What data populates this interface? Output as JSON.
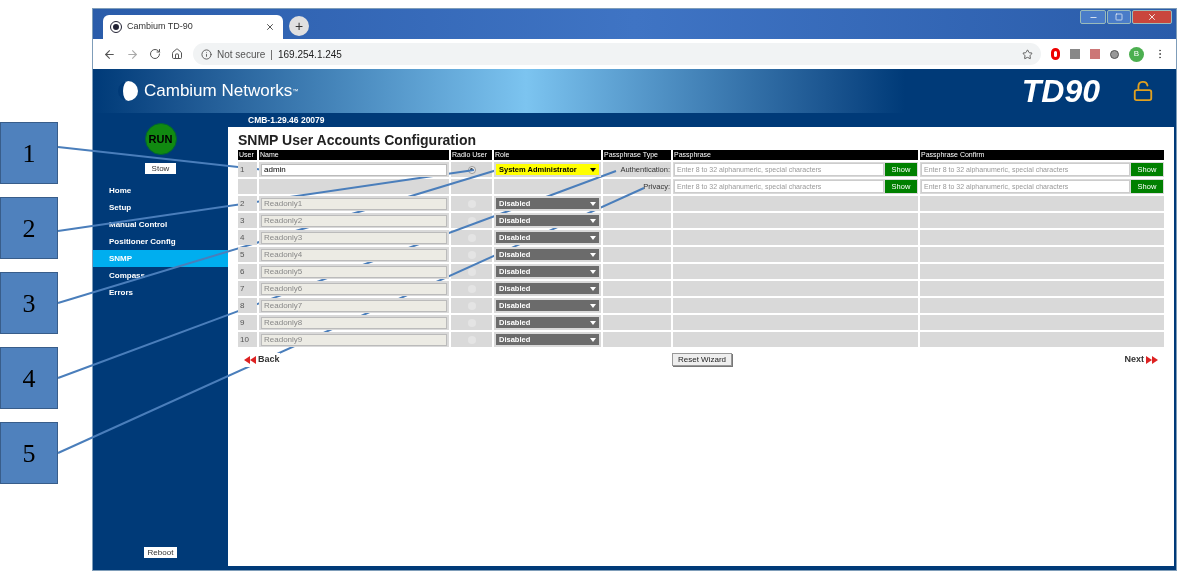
{
  "callouts": [
    "1",
    "2",
    "3",
    "4",
    "5"
  ],
  "browser": {
    "tab_title": "Cambium TD-90",
    "new_tab": "+",
    "security": "Not secure",
    "separator": "|",
    "url": "169.254.1.245",
    "profile": "B"
  },
  "header": {
    "brand": "Cambium Networks",
    "trademark": "™",
    "model": "TD90",
    "version": "CMB-1.29.46 20079"
  },
  "sidebar": {
    "status": "RUN",
    "stow": "Stow",
    "items": [
      {
        "label": "Home",
        "selected": false
      },
      {
        "label": "Setup",
        "selected": false
      },
      {
        "label": "Manual Control",
        "selected": false
      },
      {
        "label": "Positioner Config",
        "selected": false
      },
      {
        "label": "SNMP",
        "selected": true
      },
      {
        "label": "Compass",
        "selected": false
      },
      {
        "label": "Errors",
        "selected": false
      }
    ],
    "reboot": "Reboot"
  },
  "page": {
    "title": "SNMP User Accounts Configuration",
    "columns": [
      "User",
      "Name",
      "Radio User",
      "Role",
      "Passphrase Type",
      "Passphrase",
      "Passphrase Confirm"
    ],
    "users": [
      {
        "number": "1",
        "name": "admin",
        "selected": true,
        "role": "System Administrator",
        "enabled": true
      },
      {
        "number": "2",
        "name": "Readonly1",
        "selected": false,
        "role": "Disabled",
        "enabled": false
      },
      {
        "number": "3",
        "name": "Readonly2",
        "selected": false,
        "role": "Disabled",
        "enabled": false
      },
      {
        "number": "4",
        "name": "Readonly3",
        "selected": false,
        "role": "Disabled",
        "enabled": false
      },
      {
        "number": "5",
        "name": "Readonly4",
        "selected": false,
        "role": "Disabled",
        "enabled": false
      },
      {
        "number": "6",
        "name": "Readonly5",
        "selected": false,
        "role": "Disabled",
        "enabled": false
      },
      {
        "number": "7",
        "name": "Readonly6",
        "selected": false,
        "role": "Disabled",
        "enabled": false
      },
      {
        "number": "8",
        "name": "Readonly7",
        "selected": false,
        "role": "Disabled",
        "enabled": false
      },
      {
        "number": "9",
        "name": "Readonly8",
        "selected": false,
        "role": "Disabled",
        "enabled": false
      },
      {
        "number": "10",
        "name": "Readonly9",
        "selected": false,
        "role": "Disabled",
        "enabled": false
      }
    ],
    "passphrases": [
      {
        "type": "Authentication:",
        "placeholder": "Enter 8 to 32 alphanumeric, special characters",
        "show": "Show",
        "confirm_placeholder": "Enter 8 to 32 alphanumeric, special characters",
        "confirm_show": "Show"
      },
      {
        "type": "Privacy:",
        "placeholder": "Enter 8 to 32 alphanumeric, special characters",
        "show": "Show",
        "confirm_placeholder": "Enter 8 to 32 alphanumeric, special characters",
        "confirm_show": "Show"
      }
    ],
    "back": "Back",
    "reset": "Reset Wizard",
    "next": "Next"
  }
}
